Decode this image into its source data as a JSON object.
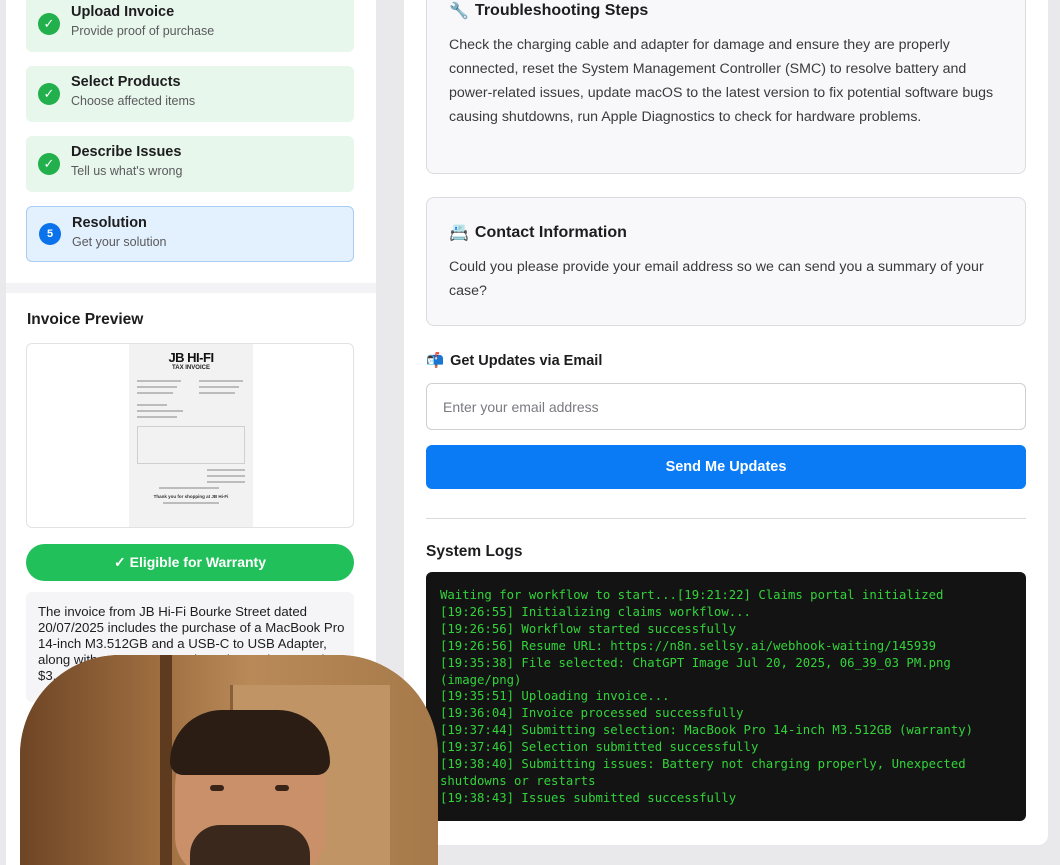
{
  "steps": [
    {
      "title": "Upload Invoice",
      "subtitle": "Provide proof of purchase",
      "badge": "✓",
      "status": "done"
    },
    {
      "title": "Select Products",
      "subtitle": "Choose affected items",
      "badge": "✓",
      "status": "done"
    },
    {
      "title": "Describe Issues",
      "subtitle": "Tell us what's wrong",
      "badge": "✓",
      "status": "done"
    },
    {
      "title": "Resolution",
      "subtitle": "Get your solution",
      "badge": "5",
      "status": "active"
    }
  ],
  "invoice_preview": {
    "title": "Invoice Preview",
    "receipt_logo": "JB HI-FI",
    "receipt_heading": "TAX INVOICE",
    "receipt_thanks": "Thank you for shopping at JB Hi-Fi"
  },
  "eligibility": {
    "label": "✓ Eligible for Warranty"
  },
  "summary_text": "The invoice from JB Hi-Fi Bourke Street dated 20/07/2025 includes the purchase of a MacBook Pro 14-inch M3.512GB and a USB-C to USB Adapter, along with a 2 Year Care Plan. The total amount is $3,",
  "troubleshooting": {
    "icon": "🔧",
    "title": "Troubleshooting Steps",
    "body": "Check the charging cable and adapter for damage and ensure they are properly connected, reset the System Management Controller (SMC) to resolve battery and power-related issues, update macOS to the latest version to fix potential software bugs causing shutdowns, run Apple Diagnostics to check for hardware problems."
  },
  "contact": {
    "icon": "📇",
    "title": "Contact Information",
    "body": "Could you please provide your email address so we can send you a summary of your case?"
  },
  "email_updates": {
    "icon": "📬",
    "label": "Get Updates via Email",
    "placeholder": "Enter your email address",
    "button": "Send Me Updates"
  },
  "logs": {
    "title": "System Logs",
    "lines": [
      "Waiting for workflow to start...[19:21:22] Claims portal initialized",
      "[19:26:55] Initializing claims workflow...",
      "[19:26:56] Workflow started successfully",
      "[19:26:56] Resume URL: https://n8n.sellsy.ai/webhook-waiting/145939",
      "[19:35:38] File selected: ChatGPT Image Jul 20, 2025, 06_39_03 PM.png (image/png)",
      "[19:35:51] Uploading invoice...",
      "[19:36:04] Invoice processed successfully",
      "[19:37:44] Submitting selection: MacBook Pro 14-inch M3.512GB (warranty)",
      "[19:37:46] Selection submitted successfully",
      "[19:38:40] Submitting issues: Battery not charging properly, Unexpected shutdowns or restarts",
      "[19:38:43] Issues submitted successfully"
    ]
  },
  "colors": {
    "success": "#22c05a",
    "primary": "#0a7bf5",
    "terminal_text": "#33d33a",
    "terminal_bg": "#131314"
  }
}
